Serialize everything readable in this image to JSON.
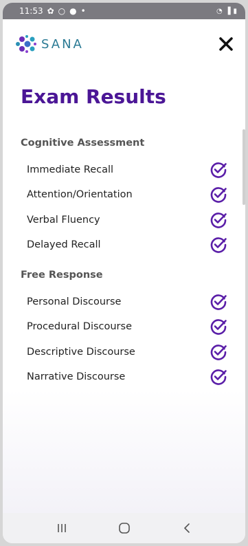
{
  "status_bar": {
    "time": "11:53"
  },
  "header": {
    "logo_text": "SANA"
  },
  "page": {
    "title": "Exam Results"
  },
  "sections": [
    {
      "title": "Cognitive Assessment",
      "items": [
        {
          "label": "Immediate Recall",
          "completed": true
        },
        {
          "label": "Attention/Orientation",
          "completed": true
        },
        {
          "label": "Verbal Fluency",
          "completed": true
        },
        {
          "label": "Delayed Recall",
          "completed": true
        }
      ]
    },
    {
      "title": "Free Response",
      "items": [
        {
          "label": "Personal Discourse",
          "completed": true
        },
        {
          "label": "Procedural Discourse",
          "completed": true
        },
        {
          "label": "Descriptive Discourse",
          "completed": true
        },
        {
          "label": "Narrative Discourse",
          "completed": true
        }
      ]
    }
  ],
  "colors": {
    "accent": "#5a1ea8",
    "title": "#4b1696",
    "logo": "#2a7a94"
  },
  "icons": {
    "close": "close-icon",
    "check": "check-circle-icon",
    "nav": [
      "recent-apps-icon",
      "home-icon",
      "back-icon"
    ]
  }
}
